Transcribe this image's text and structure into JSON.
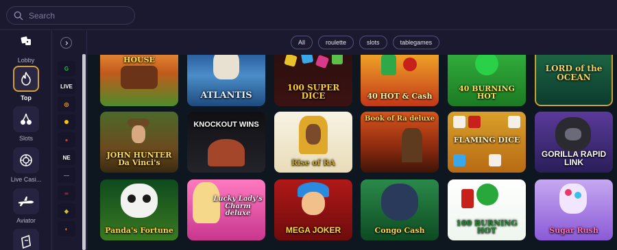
{
  "search": {
    "placeholder": "Search"
  },
  "nav": {
    "items": [
      {
        "label": "Lobby",
        "icon": "lobby-icon"
      },
      {
        "label": "Top",
        "icon": "fire-icon"
      },
      {
        "label": "Slots",
        "icon": "cherry-icon"
      },
      {
        "label": "Live Casi...",
        "icon": "roulette-icon"
      },
      {
        "label": "Aviator",
        "icon": "plane-icon"
      },
      {
        "label": "",
        "icon": "ticket-icon"
      }
    ]
  },
  "providers": [
    {
      "label": "G",
      "color": "#20c040"
    },
    {
      "label": "LIVE",
      "color": "#ffffff"
    },
    {
      "label": "◎",
      "color": "#f0a020"
    },
    {
      "label": "✺",
      "color": "#ffcc00"
    },
    {
      "label": "●",
      "color": "#e03020"
    },
    {
      "label": "NE",
      "color": "#ffffff"
    },
    {
      "label": "—",
      "color": "#8a8aa0"
    },
    {
      "label": "∞",
      "color": "#e03040"
    },
    {
      "label": "◆",
      "color": "#d0c040"
    },
    {
      "label": "◐",
      "color": "#ff8030"
    }
  ],
  "filters": [
    "All",
    "roulette",
    "slots",
    "tablegames"
  ],
  "games": {
    "row1": [
      "HOUSE",
      "ATLANTIS",
      "100 SUPER DICE",
      "40 HOT & Cash",
      "40 BURNING HOT",
      "LORD of the OCEAN"
    ],
    "row2": [
      "JOHN HUNTER Da Vinci's",
      "KNOCKOUT WINS",
      "Rise of RA",
      "Book of Ra deluxe",
      "FLAMING DICE",
      "GORILLA RAPID LINK"
    ],
    "row3": [
      "Panda's Fortune",
      "Lucky Lady's Charm deluxe",
      "MEGA JOKER",
      "Congo Cash",
      "100 BURNING HOT",
      "Sugar Rush"
    ]
  },
  "colors": {
    "accent": "#d3a13a",
    "background": "#1b1930",
    "grid_background": "#0e1720"
  }
}
